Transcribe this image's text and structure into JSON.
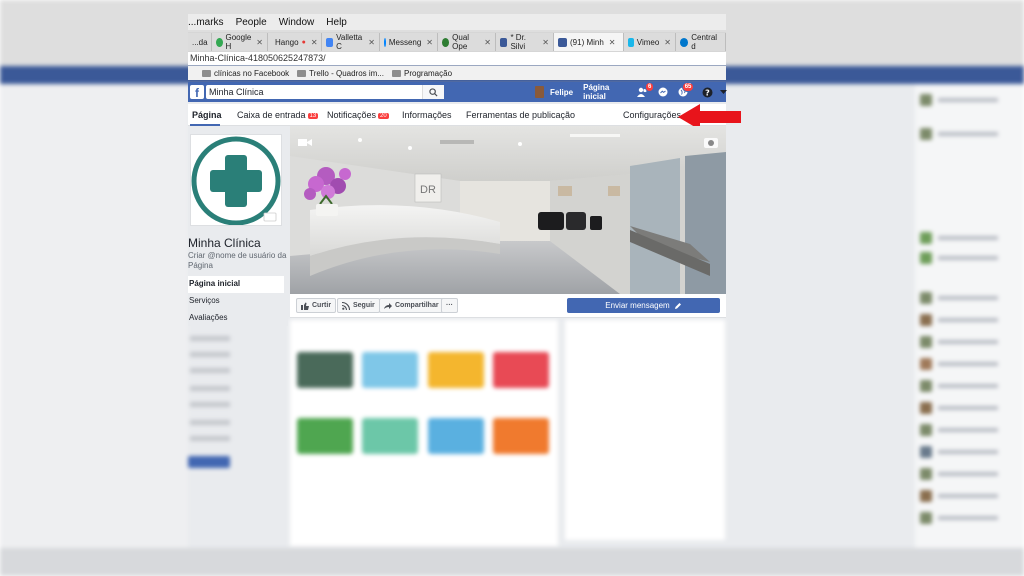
{
  "menubar": {
    "items": [
      "...marks",
      "People",
      "Window",
      "Help"
    ]
  },
  "tabs": [
    {
      "label": "...da",
      "favicon_color": "#888888"
    },
    {
      "label": "Google H",
      "favicon_color": "#34a853"
    },
    {
      "label": "Hango",
      "favicon_color": "#0f9d58"
    },
    {
      "label": "Valletta C",
      "favicon_color": "#4285f4"
    },
    {
      "label": "Messeng",
      "favicon_color": "#0084ff"
    },
    {
      "label": "Qual Ope",
      "favicon_color": "#2e7d32"
    },
    {
      "label": "* Dr. Silvi",
      "favicon_color": "#3b5998"
    },
    {
      "label": "(91) Minh",
      "favicon_color": "#3b5998",
      "active": true
    },
    {
      "label": "Vimeo",
      "favicon_color": "#1ab7ea"
    },
    {
      "label": "Central d",
      "favicon_color": "#0077cc"
    }
  ],
  "url": "Minha-Clínica-418050625247873/",
  "bookmarks": [
    {
      "label": "clínicas no Facebook"
    },
    {
      "label": "Trello - Quadros im..."
    },
    {
      "label": "Programação"
    }
  ],
  "fbbar": {
    "search_value": "Minha Clínica",
    "user_name": "Felipe",
    "home_label": "Página inicial",
    "friend_requests_count": "6",
    "notifications_count": "65"
  },
  "page_nav": {
    "items": [
      {
        "label": "Página",
        "active": true
      },
      {
        "label": "Caixa de entrada",
        "count": "13"
      },
      {
        "label": "Notificações",
        "count": "20"
      },
      {
        "label": "Informações"
      },
      {
        "label": "Ferramentas de publicação"
      },
      {
        "label": "Configurações"
      }
    ]
  },
  "page": {
    "name": "Minha Clínica",
    "username_prompt": "Criar @nome de usuário da Página",
    "left_nav": [
      {
        "label": "Página inicial",
        "active": true
      },
      {
        "label": "Serviços"
      },
      {
        "label": "Avaliações"
      }
    ]
  },
  "actions": {
    "like": "Curtir",
    "follow": "Seguir",
    "share": "Compartilhar",
    "more": "···",
    "send_message": "Enviar mensagem"
  },
  "colors": {
    "fb_blue": "#4267b2",
    "badge_red": "#fa3e3e",
    "logo_teal": "#2a7f78",
    "arrow_red": "#e8141b"
  }
}
